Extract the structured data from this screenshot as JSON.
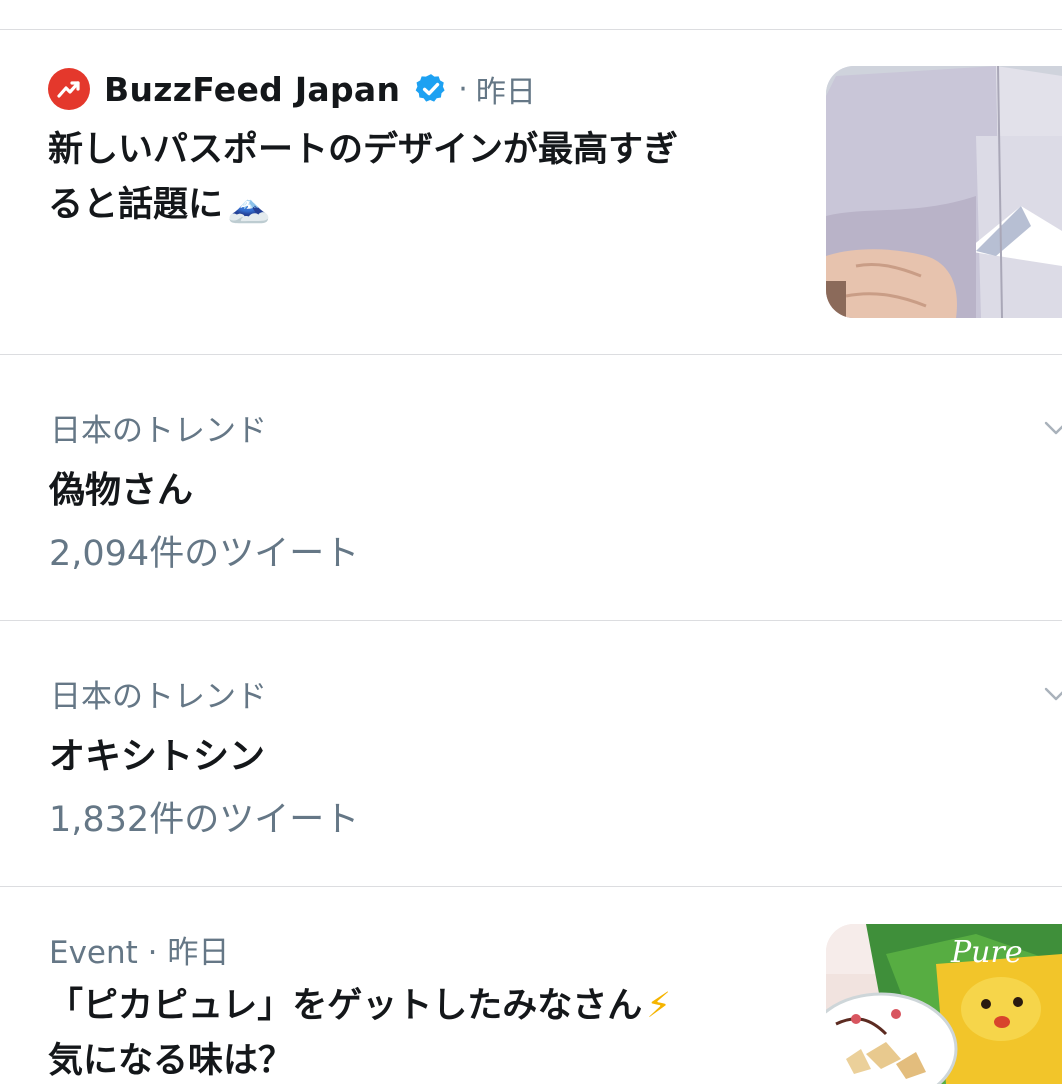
{
  "story": {
    "source_name": "BuzzFeed Japan",
    "meta_separator": "·",
    "time": "昨日",
    "headline_line1": "新しいパスポートのデザインが最高すぎ",
    "headline_line2": "ると話題に",
    "headline_emoji": "🗻",
    "icons": {
      "logo": "buzzfeed-trending-arrow",
      "verified": "verified-badge"
    }
  },
  "trends": [
    {
      "label": "日本のトレンド",
      "title": "偽物さん",
      "count": "2,094件のツイート"
    },
    {
      "label": "日本のトレンド",
      "title": "オキシトシン",
      "count": "1,832件のツイート"
    }
  ],
  "event": {
    "category": "Event",
    "separator": "·",
    "time": "昨日",
    "headline_line1": "「ピカピュレ」をゲットしたみなさん",
    "headline_emoji": "⚡",
    "headline_line2": "気になる味は？"
  },
  "colors": {
    "accent_red": "#e4382c",
    "verified_blue": "#1da1f2",
    "secondary_text": "#657786",
    "divider": "#dcdde0"
  }
}
